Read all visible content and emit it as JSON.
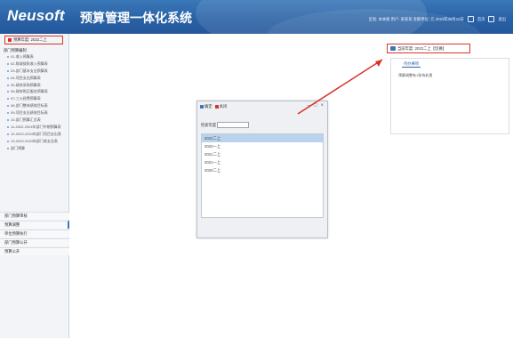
{
  "header": {
    "logo": "Neusoft",
    "title": "预算管理一体化系统",
    "user_info": "区划: 本本级 用户: 某某某 金额单位: 元 2023年08月10日",
    "home_label": "首页",
    "exit_label": "退出"
  },
  "sidebar": {
    "budget_year": "预算年度: 2022二上",
    "tree_root": "部门预算编制",
    "tree_items": [
      "01-收入预算表",
      "02-财政拨款收入预算表",
      "03-部门基本支出预算表",
      "04-项目支出预算表",
      "05-政府采购预算表",
      "06-政府购买服务预算表",
      "07-三公经费预算表",
      "08-部门整体绩效目标表",
      "09-项目支出绩效目标表",
      "10-部门预算汇总表",
      "11-2022-2024年部门中期预算表",
      "12-2022-2024年部门项目支出表",
      "13-2022-2024年部门收支总表",
      "部门预算"
    ],
    "groups": [
      "部门预算审核",
      "预算调整",
      "单位预算执行",
      "部门预算公开",
      "预算公开"
    ]
  },
  "main": {
    "notice_top": "当前年度: 2022二上【切换】",
    "panel_tab": "待办事项",
    "panel_line": "预算调整有1条待处理"
  },
  "dialog": {
    "ok_label": "确定",
    "close_label": "关闭",
    "search_label": "检索年度",
    "search_value": "",
    "items": [
      "2022二上",
      "2022一上",
      "2021二上",
      "2021一上",
      "2020二上"
    ],
    "selected_index": 0
  }
}
